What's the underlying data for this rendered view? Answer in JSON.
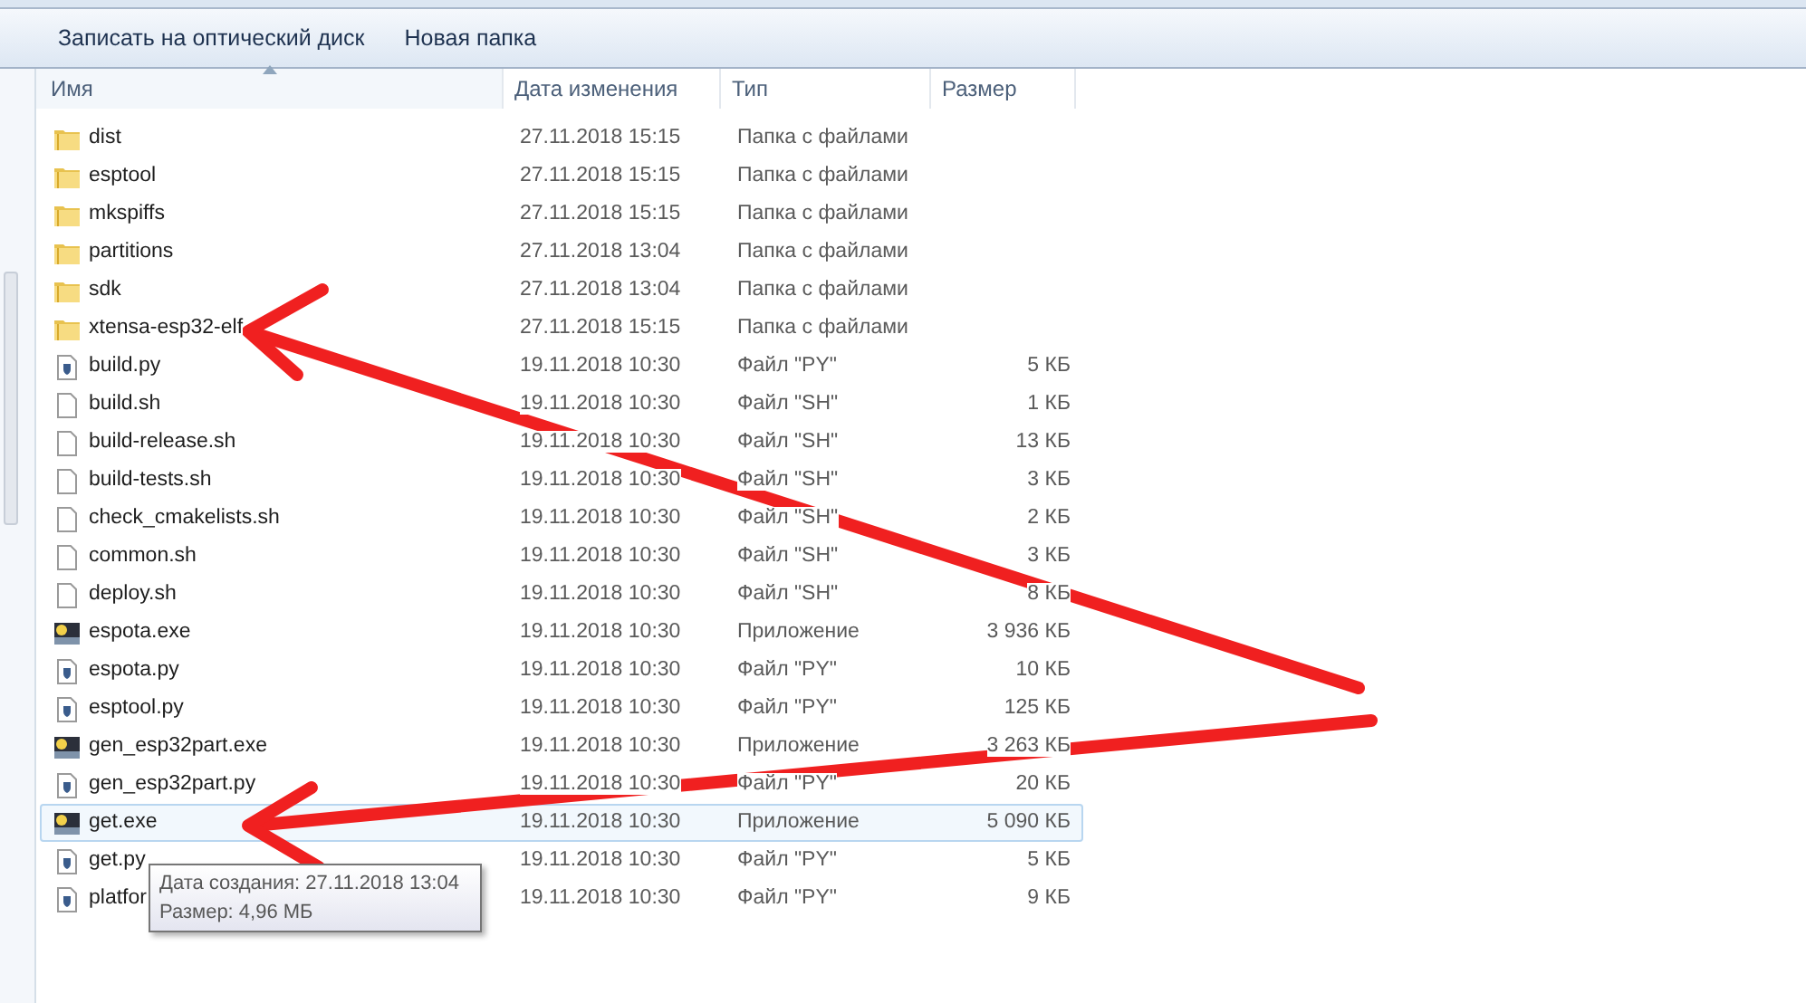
{
  "toolbar": {
    "buttons": [
      "Записать на оптический диск",
      "Новая папка"
    ]
  },
  "columns": [
    {
      "label": "Имя",
      "sorted": true
    },
    {
      "label": "Дата изменения",
      "sorted": false
    },
    {
      "label": "Тип",
      "sorted": false
    },
    {
      "label": "Размер",
      "sorted": false
    }
  ],
  "rows": [
    {
      "kind": "folder",
      "name": "dist",
      "date": "27.11.2018 15:15",
      "type": "Папка с файлами",
      "selected": false
    },
    {
      "kind": "folder",
      "name": "esptool",
      "date": "27.11.2018 15:15",
      "type": "Папка с файлами",
      "selected": false
    },
    {
      "kind": "folder",
      "name": "mkspiffs",
      "date": "27.11.2018 15:15",
      "type": "Папка с файлами",
      "selected": false
    },
    {
      "kind": "folder",
      "name": "partitions",
      "date": "27.11.2018 13:04",
      "type": "Папка с файлами",
      "selected": false
    },
    {
      "kind": "folder",
      "name": "sdk",
      "date": "27.11.2018 13:04",
      "type": "Папка с файлами",
      "selected": false
    },
    {
      "kind": "folder",
      "name": "xtensa-esp32-elf",
      "date": "27.11.2018 15:15",
      "type": "Папка с файлами",
      "selected": false
    },
    {
      "kind": "script",
      "name": "build.py",
      "date": "19.11.2018 10:30",
      "type": "Файл \"PY\"",
      "size": "5 КБ",
      "selected": false
    },
    {
      "kind": "file",
      "name": "build.sh",
      "date": "19.11.2018 10:30",
      "type": "Файл \"SH\"",
      "size": "1 КБ",
      "selected": false
    },
    {
      "kind": "file",
      "name": "build-release.sh",
      "date": "19.11.2018 10:30",
      "type": "Файл \"SH\"",
      "size": "13 КБ",
      "selected": false
    },
    {
      "kind": "file",
      "name": "build-tests.sh",
      "date": "19.11.2018 10:30",
      "type": "Файл \"SH\"",
      "size": "3 КБ",
      "selected": false
    },
    {
      "kind": "file",
      "name": "check_cmakelists.sh",
      "date": "19.11.2018 10:30",
      "type": "Файл \"SH\"",
      "size": "2 КБ",
      "selected": false
    },
    {
      "kind": "file",
      "name": "common.sh",
      "date": "19.11.2018 10:30",
      "type": "Файл \"SH\"",
      "size": "3 КБ",
      "selected": false
    },
    {
      "kind": "file",
      "name": "deploy.sh",
      "date": "19.11.2018 10:30",
      "type": "Файл \"SH\"",
      "size": "8 КБ",
      "selected": false
    },
    {
      "kind": "exe",
      "name": "espota.exe",
      "date": "19.11.2018 10:30",
      "type": "Приложение",
      "size": "3 936 КБ",
      "selected": false
    },
    {
      "kind": "script",
      "name": "espota.py",
      "date": "19.11.2018 10:30",
      "type": "Файл \"PY\"",
      "size": "10 КБ",
      "selected": false
    },
    {
      "kind": "script",
      "name": "esptool.py",
      "date": "19.11.2018 10:30",
      "type": "Файл \"PY\"",
      "size": "125 КБ",
      "selected": false
    },
    {
      "kind": "exe",
      "name": "gen_esp32part.exe",
      "date": "19.11.2018 10:30",
      "type": "Приложение",
      "size": "3 263 КБ",
      "selected": false
    },
    {
      "kind": "script",
      "name": "gen_esp32part.py",
      "date": "19.11.2018 10:30",
      "type": "Файл \"PY\"",
      "size": "20 КБ",
      "selected": false
    },
    {
      "kind": "exe",
      "name": "get.exe",
      "date": "19.11.2018 10:30",
      "type": "Приложение",
      "size": "5 090 КБ",
      "selected": true
    },
    {
      "kind": "script",
      "name": "get.py",
      "date": "19.11.2018 10:30",
      "type": "Файл \"PY\"",
      "size": "5 КБ",
      "selected": false
    },
    {
      "kind": "script",
      "name": "platfor",
      "date": "19.11.2018 10:30",
      "type": "Файл \"PY\"",
      "size": "9 КБ",
      "selected": false
    }
  ],
  "tooltip": {
    "lines": [
      "Дата создания: 27.11.2018 13:04",
      "Размер: 4,96 МБ"
    ]
  }
}
